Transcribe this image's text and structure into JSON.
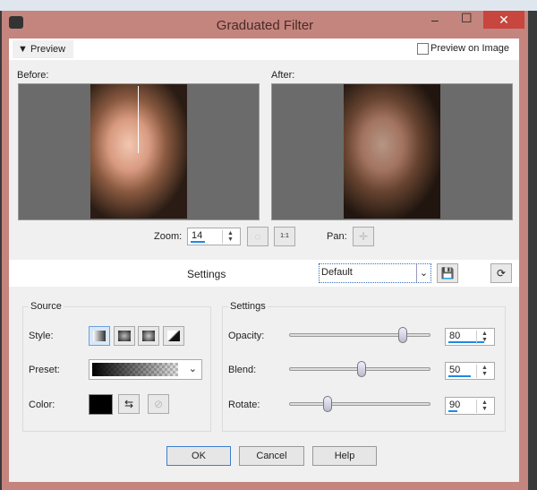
{
  "window": {
    "title": "Graduated Filter",
    "close": "✕",
    "maximize": "☐",
    "minimize": "–"
  },
  "preview_bar": {
    "label": "Preview",
    "preview_on_image": "Preview on Image",
    "preview_on_image_checked": false
  },
  "before_label": "Before:",
  "after_label": "After:",
  "zoom": {
    "label": "Zoom:",
    "value": "14",
    "pan_label": "Pan:",
    "one_to_one": "1:1"
  },
  "settings_bar": {
    "label": "Settings",
    "preset": "Default"
  },
  "source": {
    "title": "Source",
    "style_label": "Style:",
    "preset_label": "Preset:",
    "color_label": "Color:",
    "color": "#000000",
    "selected_style": "linear"
  },
  "settings": {
    "title": "Settings",
    "opacity_label": "Opacity:",
    "opacity": "80",
    "blend_label": "Blend:",
    "blend": "50",
    "rotate_label": "Rotate:",
    "rotate": "90"
  },
  "buttons": {
    "ok": "OK",
    "cancel": "Cancel",
    "help": "Help"
  }
}
